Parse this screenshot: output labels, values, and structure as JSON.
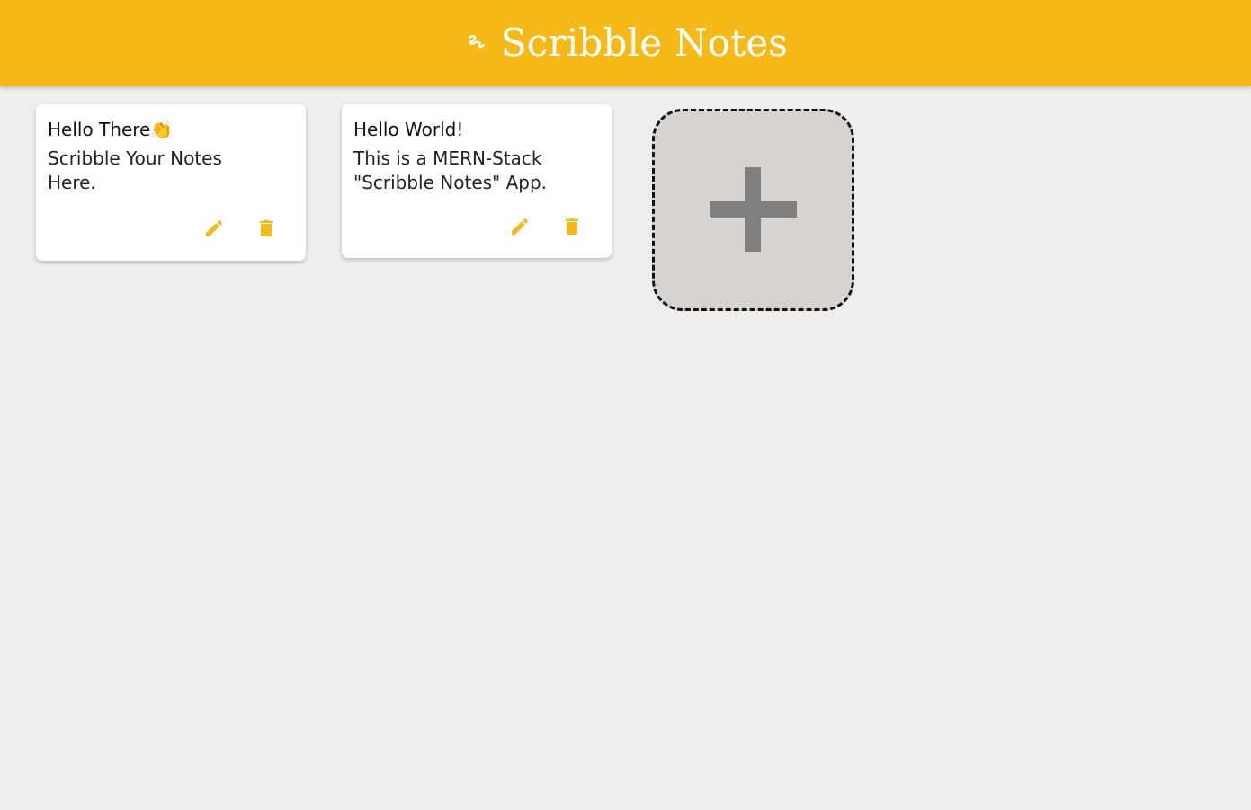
{
  "header": {
    "icon": "scribble-icon",
    "title": "Scribble Notes"
  },
  "notes": [
    {
      "title": "Hello There👏",
      "content": "Scribble Your Notes Here.",
      "actions": [
        "edit-icon",
        "delete-icon"
      ]
    },
    {
      "title": "Hello World!",
      "content": "This is a MERN-Stack \"Scribble Notes\" App.",
      "actions": [
        "edit-icon",
        "delete-icon"
      ]
    }
  ],
  "add_note": {
    "icon": "plus-icon"
  },
  "colors": {
    "accent": "#f5ba18",
    "background": "#eeeeee",
    "card": "#ffffff",
    "add_tile": "#d5d4d2",
    "plus": "#808080"
  }
}
